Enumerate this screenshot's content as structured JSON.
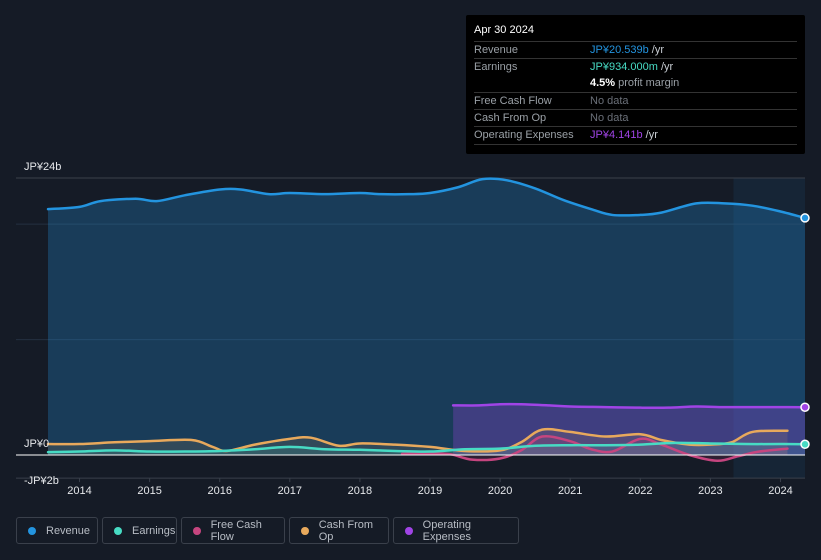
{
  "tooltip": {
    "date": "Apr 30 2024",
    "rows": [
      {
        "label": "Revenue",
        "value": "JP¥20.539b",
        "unit": " /yr",
        "color": "#2394df"
      },
      {
        "label": "Earnings",
        "value": "JP¥934.000m",
        "unit": " /yr",
        "color": "#47dbc4"
      },
      {
        "label": "",
        "value": "4.5%",
        "unit": " profit margin",
        "color": "#ffffff"
      },
      {
        "label": "Free Cash Flow",
        "value": "No data",
        "unit": "",
        "color": "#6b7079"
      },
      {
        "label": "Cash From Op",
        "value": "No data",
        "unit": "",
        "color": "#6b7079"
      },
      {
        "label": "Operating Expenses",
        "value": "JP¥4.141b",
        "unit": " /yr",
        "color": "#a044e6"
      }
    ]
  },
  "legend": [
    {
      "label": "Revenue",
      "color": "#2394df"
    },
    {
      "label": "Earnings",
      "color": "#47dbc4"
    },
    {
      "label": "Free Cash Flow",
      "color": "#c5457f"
    },
    {
      "label": "Cash From Op",
      "color": "#e8a95c"
    },
    {
      "label": "Operating Expenses",
      "color": "#a044e6"
    }
  ],
  "chart_data": {
    "type": "area",
    "title": "",
    "xlabel": "",
    "ylabel": "",
    "ylim": [
      -2,
      24
    ],
    "y_tick_labels": [
      {
        "value": 24,
        "label": "JP¥24b"
      },
      {
        "value": 0,
        "label": "JP¥0"
      },
      {
        "value": -2,
        "label": "-JP¥2b"
      }
    ],
    "x_tick_labels": [
      "2014",
      "2015",
      "2016",
      "2017",
      "2018",
      "2019",
      "2020",
      "2021",
      "2022",
      "2023",
      "2024"
    ],
    "xlim": [
      2013.55,
      2024.35
    ],
    "highlight_from": 2023.33,
    "series": [
      {
        "name": "Revenue",
        "color": "#2394df",
        "marker_end": true,
        "x": [
          2013.55,
          2014.0,
          2014.3,
          2014.8,
          2015.1,
          2015.5,
          2016.0,
          2016.3,
          2016.7,
          2017.0,
          2017.5,
          2018.0,
          2018.3,
          2018.7,
          2019.0,
          2019.4,
          2019.75,
          2020.1,
          2020.5,
          2020.9,
          2021.3,
          2021.6,
          2022.0,
          2022.3,
          2022.8,
          2023.2,
          2023.6,
          2024.0,
          2024.35
        ],
        "y": [
          21.3,
          21.5,
          22.0,
          22.2,
          22.0,
          22.5,
          23.0,
          23.0,
          22.6,
          22.7,
          22.6,
          22.7,
          22.6,
          22.6,
          22.7,
          23.2,
          23.9,
          23.8,
          23.1,
          22.1,
          21.3,
          20.8,
          20.8,
          21.0,
          21.8,
          21.8,
          21.6,
          21.1,
          20.54
        ]
      },
      {
        "name": "Earnings",
        "color": "#47dbc4",
        "marker_end": true,
        "x": [
          2013.55,
          2014.0,
          2014.5,
          2015.0,
          2015.5,
          2016.0,
          2016.5,
          2017.0,
          2017.5,
          2018.0,
          2018.5,
          2019.0,
          2019.5,
          2020.0,
          2020.5,
          2021.0,
          2021.5,
          2022.0,
          2022.5,
          2023.0,
          2023.5,
          2024.0,
          2024.35
        ],
        "y": [
          0.25,
          0.3,
          0.4,
          0.3,
          0.3,
          0.35,
          0.5,
          0.7,
          0.5,
          0.45,
          0.35,
          0.3,
          0.5,
          0.55,
          0.8,
          0.85,
          0.85,
          0.9,
          1.05,
          1.0,
          0.95,
          0.95,
          0.93
        ]
      },
      {
        "name": "Free Cash Flow",
        "color": "#c5457f",
        "marker_end": false,
        "x": [
          2018.6,
          2019.0,
          2019.3,
          2019.6,
          2020.0,
          2020.3,
          2020.6,
          2021.0,
          2021.3,
          2021.6,
          2022.0,
          2022.3,
          2022.7,
          2023.1,
          2023.4,
          2023.7,
          2024.1
        ],
        "y": [
          0.1,
          0.15,
          0.05,
          -0.4,
          -0.3,
          0.4,
          1.6,
          1.2,
          0.5,
          0.3,
          1.4,
          0.9,
          0.0,
          -0.5,
          -0.1,
          0.3,
          0.55
        ]
      },
      {
        "name": "Cash From Op",
        "color": "#e8a95c",
        "marker_end": false,
        "x": [
          2013.55,
          2014.0,
          2014.5,
          2015.0,
          2015.6,
          2015.9,
          2016.1,
          2016.5,
          2017.0,
          2017.3,
          2017.7,
          2018.0,
          2018.5,
          2019.0,
          2019.5,
          2020.0,
          2020.3,
          2020.6,
          2021.0,
          2021.5,
          2022.0,
          2022.3,
          2022.7,
          2023.0,
          2023.3,
          2023.6,
          2024.1
        ],
        "y": [
          0.95,
          0.95,
          1.1,
          1.2,
          1.3,
          0.7,
          0.35,
          0.9,
          1.4,
          1.5,
          0.8,
          1.0,
          0.9,
          0.7,
          0.35,
          0.4,
          1.1,
          2.2,
          2.0,
          1.6,
          1.8,
          1.3,
          0.9,
          0.9,
          1.1,
          2.0,
          2.1
        ]
      },
      {
        "name": "Operating Expenses",
        "color": "#a044e6",
        "marker_end": true,
        "x": [
          2019.33,
          2019.7,
          2020.0,
          2020.3,
          2020.7,
          2021.0,
          2021.5,
          2022.0,
          2022.4,
          2022.8,
          2023.2,
          2023.6,
          2024.0,
          2024.35
        ],
        "y": [
          4.3,
          4.3,
          4.4,
          4.4,
          4.3,
          4.2,
          4.15,
          4.1,
          4.1,
          4.2,
          4.15,
          4.15,
          4.15,
          4.14
        ]
      }
    ]
  }
}
